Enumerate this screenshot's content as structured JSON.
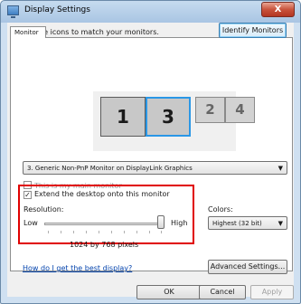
{
  "window": {
    "title": "Display Settings",
    "close_label": "X"
  },
  "tab": {
    "label": "Monitor"
  },
  "instructions": "Drag the icons to match your monitors.",
  "identify_button": "Identify Monitors",
  "monitors": [
    "1",
    "3",
    "2",
    "4"
  ],
  "monitor_select": {
    "value": "3. Generic Non-PnP Monitor on DisplayLink Graphics"
  },
  "main_monitor": {
    "label": "This is my main monitor",
    "checked": false
  },
  "extend_desktop": {
    "label": "Extend the desktop onto this monitor",
    "checked": true
  },
  "resolution": {
    "label": "Resolution:",
    "low": "Low",
    "high": "High",
    "value_text": "1024 by 768 pixels",
    "slider_fraction": 0.95
  },
  "colors": {
    "label": "Colors:",
    "value": "Highest (32 bit)"
  },
  "help_link": "How do I get the best display?",
  "buttons": {
    "advanced": "Advanced Settings...",
    "ok": "OK",
    "cancel": "Cancel",
    "apply": "Apply"
  },
  "accent_colors": {
    "selected_monitor_border": "#2a97e6",
    "highlight_box": "#e00000"
  }
}
